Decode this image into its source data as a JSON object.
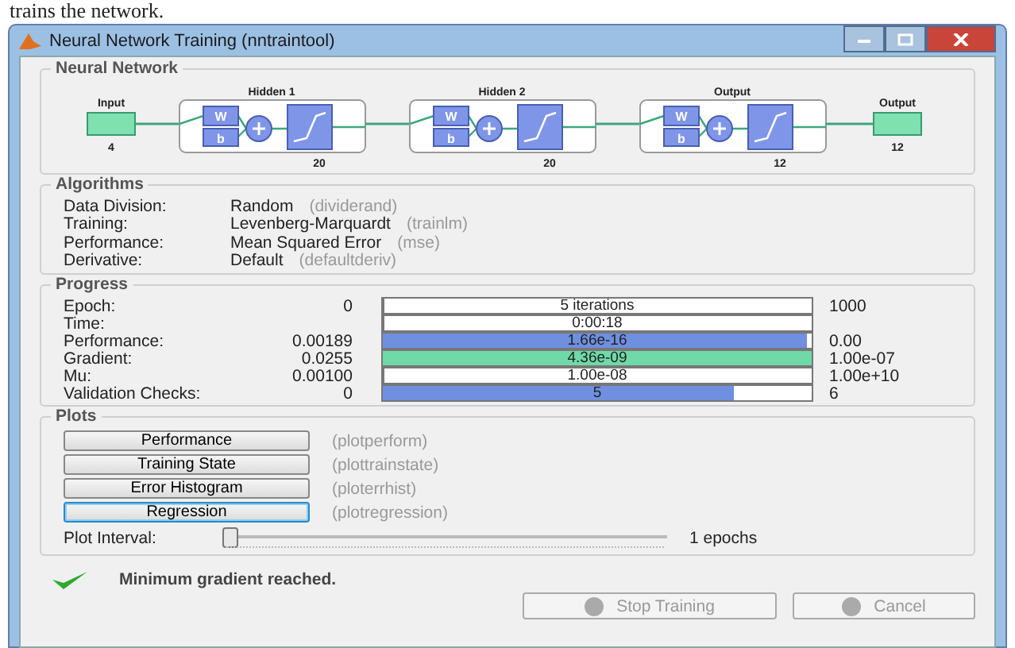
{
  "caption_above": "trains the network.",
  "window": {
    "title": "Neural Network Training (nntraintool)"
  },
  "neural_network": {
    "title": "Neural Network",
    "input": {
      "label": "Input",
      "size": "4"
    },
    "layers": [
      {
        "title": "Hidden 1",
        "w": "W",
        "b": "b",
        "size": "20"
      },
      {
        "title": "Hidden 2",
        "w": "W",
        "b": "b",
        "size": "20"
      },
      {
        "title": "Output",
        "w": "W",
        "b": "b",
        "size": "12"
      }
    ],
    "output": {
      "label": "Output",
      "size": "12"
    }
  },
  "algorithms": {
    "title": "Algorithms",
    "rows": [
      {
        "label": "Data Division:",
        "value": "Random",
        "function": "(dividerand)"
      },
      {
        "label": "Training:",
        "value": "Levenberg-Marquardt",
        "function": "(trainlm)"
      },
      {
        "label": "Performance:",
        "value": "Mean Squared Error",
        "function": "(mse)"
      },
      {
        "label": "Derivative:",
        "value": "Default",
        "function": "(defaultderiv)"
      }
    ]
  },
  "progress": {
    "title": "Progress",
    "rows": [
      {
        "label": "Epoch:",
        "start": "0",
        "bar_text": "5 iterations",
        "level": 0,
        "end": "1000"
      },
      {
        "label": "Time:",
        "bar_text": "0:00:18",
        "level": 0
      },
      {
        "label": "Performance:",
        "start": "0.00189",
        "bar_text": "1.66e-16",
        "level": 0.99,
        "color": "#6f8fe0",
        "end": "0.00"
      },
      {
        "label": "Gradient:",
        "start": "0.0255",
        "bar_text": "4.36e-09",
        "level": 1,
        "color": "#6fd9a8",
        "end": "1.00e-07"
      },
      {
        "label": "Mu:",
        "start": "0.00100",
        "bar_text": "1.00e-08",
        "level": 0,
        "end": "1.00e+10"
      },
      {
        "label": "Validation Checks:",
        "start": "0",
        "bar_text": "5",
        "level": 0.82,
        "color": "#6f8fe0",
        "end": "6"
      }
    ]
  },
  "plots": {
    "title": "Plots",
    "buttons": [
      {
        "label": "Performance",
        "function": "(plotperform)",
        "focused": false
      },
      {
        "label": "Training State",
        "function": "(plottrainstate)",
        "focused": false
      },
      {
        "label": "Error Histogram",
        "function": "(ploterrhist)",
        "focused": false
      },
      {
        "label": "Regression",
        "function": "(plotregression)",
        "focused": true
      }
    ],
    "interval": {
      "label": "Plot Interval:",
      "level": 0,
      "reading": "1 epochs"
    }
  },
  "status": "Minimum gradient reached.",
  "buttons": [
    {
      "label": "Stop Training",
      "disabled": true
    },
    {
      "label": "Cancel",
      "disabled": true
    }
  ]
}
